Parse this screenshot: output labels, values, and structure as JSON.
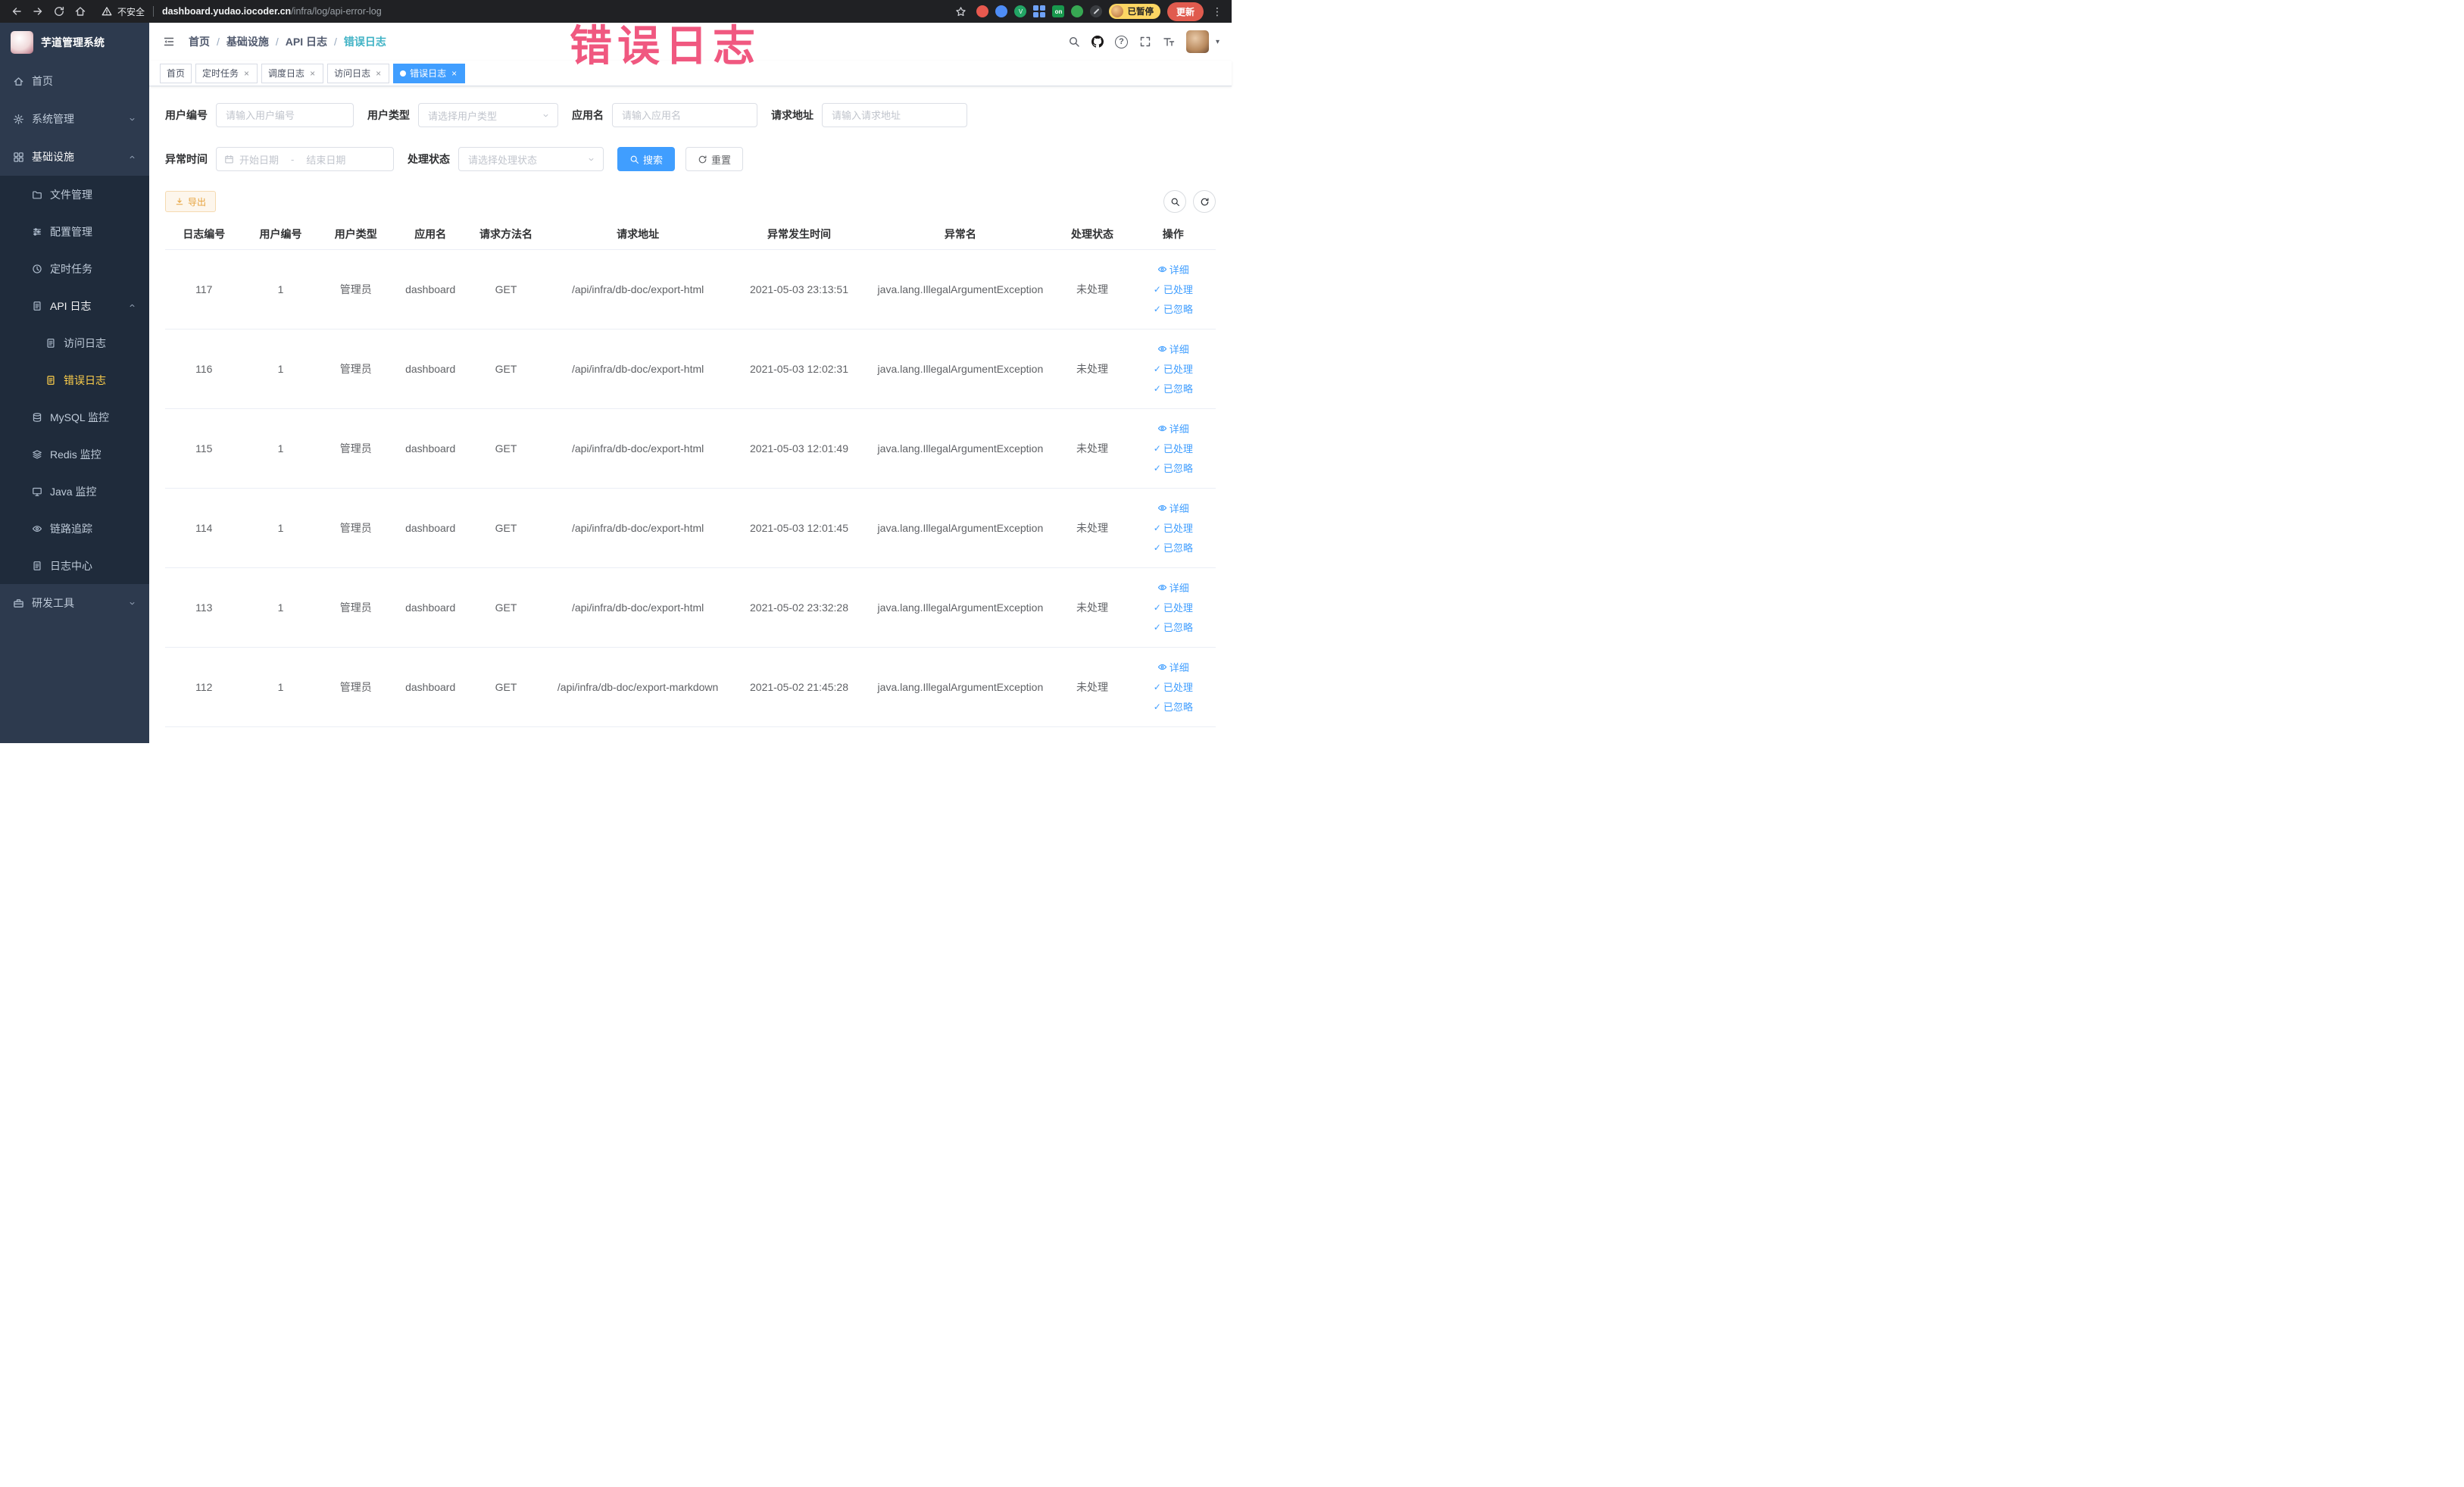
{
  "annotation": {
    "text": "错误日志"
  },
  "colors": {
    "accent_blue": "#409eff",
    "export_orange": "#e6a23c",
    "sidebar_active_yellow": "#ffd04b",
    "annotation_pink": "#f0507a",
    "breadcrumb_current_teal": "#3eb2c5"
  },
  "icons": {
    "close": "×",
    "check": "✓",
    "caret_down": "▾",
    "kebab": "⋮",
    "question": "?"
  },
  "browser": {
    "security_label": "不安全",
    "url_domain": "dashboard.yudao.iocoder.cn",
    "url_path": "/infra/log/api-error-log",
    "paused_badge": "已暂停",
    "update_button": "更新",
    "extension_on_badge": "on"
  },
  "sidebar": {
    "logo_title": "芋道管理系统",
    "menu": {
      "home": "首页",
      "system": "系统管理",
      "infra": "基础设施",
      "file": "文件管理",
      "config": "配置管理",
      "job": "定时任务",
      "api_log": "API 日志",
      "access_log": "访问日志",
      "error_log": "错误日志",
      "mysql": "MySQL 监控",
      "redis": "Redis 监控",
      "java": "Java 监控",
      "trace": "链路追踪",
      "log_center": "日志中心",
      "dev_tools": "研发工具"
    }
  },
  "header": {
    "breadcrumb": {
      "home": "首页",
      "infra": "基础设施",
      "api_log": "API 日志",
      "current": "错误日志",
      "separator": "/"
    }
  },
  "tabs": {
    "home": "首页",
    "scheduled_job": "定时任务",
    "job_log": "调度日志",
    "access_log": "访问日志",
    "error_log": "错误日志"
  },
  "filters": {
    "user_id": {
      "label": "用户编号",
      "placeholder": "请输入用户编号"
    },
    "user_type": {
      "label": "用户类型",
      "placeholder": "请选择用户类型"
    },
    "app_name": {
      "label": "应用名",
      "placeholder": "请输入应用名"
    },
    "request_url": {
      "label": "请求地址",
      "placeholder": "请输入请求地址"
    },
    "exception_time": {
      "label": "异常时间",
      "start_placeholder": "开始日期",
      "separator": "-",
      "end_placeholder": "结束日期"
    },
    "process_status": {
      "label": "处理状态",
      "placeholder": "请选择处理状态"
    },
    "search_button": "搜索",
    "reset_button": "重置"
  },
  "toolbar": {
    "export_button": "导出"
  },
  "table": {
    "columns": [
      "日志编号",
      "用户编号",
      "用户类型",
      "应用名",
      "请求方法名",
      "请求地址",
      "异常发生时间",
      "异常名",
      "处理状态",
      "操作"
    ],
    "action_labels": {
      "detail": "详细",
      "processed": "已处理",
      "ignored": "已忽略"
    },
    "rows": [
      {
        "id": "117",
        "user_id": "1",
        "user_type": "管理员",
        "app": "dashboard",
        "method": "GET",
        "url": "/api/infra/db-doc/export-html",
        "time": "2021-05-03 23:13:51",
        "exception": "java.lang.IllegalArgumentException",
        "status": "未处理"
      },
      {
        "id": "116",
        "user_id": "1",
        "user_type": "管理员",
        "app": "dashboard",
        "method": "GET",
        "url": "/api/infra/db-doc/export-html",
        "time": "2021-05-03 12:02:31",
        "exception": "java.lang.IllegalArgumentException",
        "status": "未处理"
      },
      {
        "id": "115",
        "user_id": "1",
        "user_type": "管理员",
        "app": "dashboard",
        "method": "GET",
        "url": "/api/infra/db-doc/export-html",
        "time": "2021-05-03 12:01:49",
        "exception": "java.lang.IllegalArgumentException",
        "status": "未处理"
      },
      {
        "id": "114",
        "user_id": "1",
        "user_type": "管理员",
        "app": "dashboard",
        "method": "GET",
        "url": "/api/infra/db-doc/export-html",
        "time": "2021-05-03 12:01:45",
        "exception": "java.lang.IllegalArgumentException",
        "status": "未处理"
      },
      {
        "id": "113",
        "user_id": "1",
        "user_type": "管理员",
        "app": "dashboard",
        "method": "GET",
        "url": "/api/infra/db-doc/export-html",
        "time": "2021-05-02 23:32:28",
        "exception": "java.lang.IllegalArgumentException",
        "status": "未处理"
      },
      {
        "id": "112",
        "user_id": "1",
        "user_type": "管理员",
        "app": "dashboard",
        "method": "GET",
        "url": "/api/infra/db-doc/export-markdown",
        "time": "2021-05-02 21:45:28",
        "exception": "java.lang.IllegalArgumentException",
        "status": "未处理"
      }
    ]
  }
}
